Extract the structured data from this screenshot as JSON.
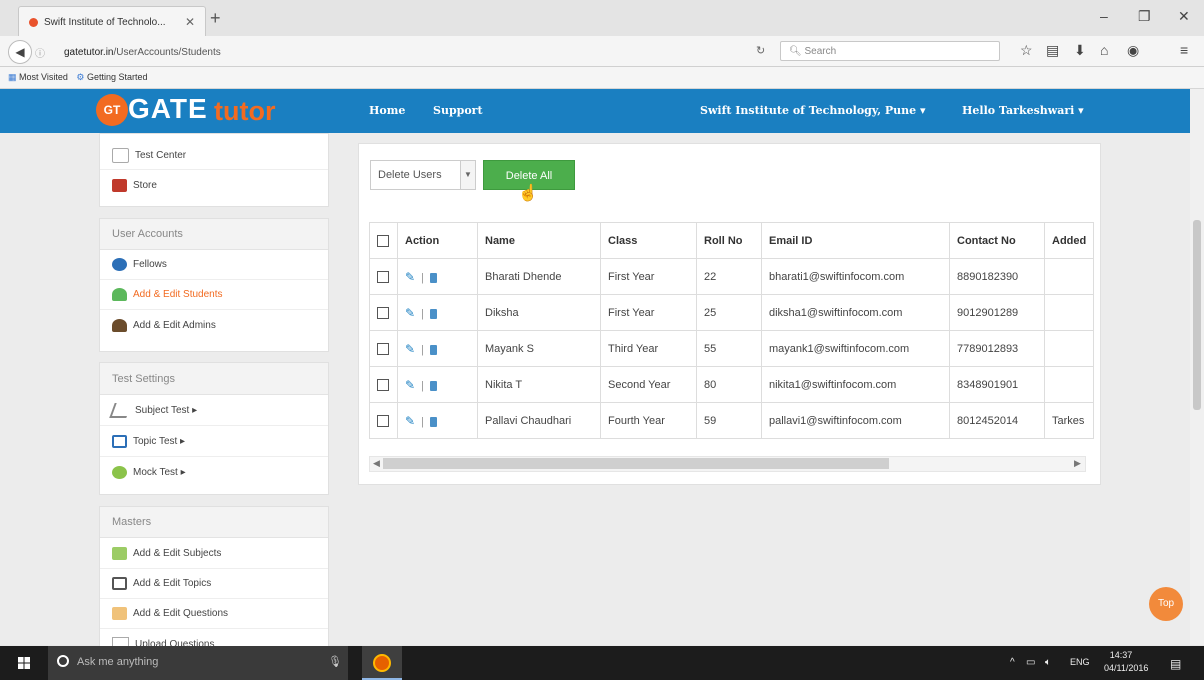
{
  "browser": {
    "tab_title": "Swift Institute of Technolo...",
    "url_host": "gatetutor.in",
    "url_path": "/UserAccounts/Students",
    "search_placeholder": "Search",
    "bookmark_most_visited": "Most Visited",
    "bookmark_getting_started": "Getting Started"
  },
  "site": {
    "logo_badge": "GT",
    "logo_gate": "GATE",
    "logo_tutor": "tutor",
    "nav_home": "Home",
    "nav_support": "Support",
    "institute": "Swift Institute of Technology, Pune ▾",
    "greeting": "Hello Tarkeshwari ▾"
  },
  "sidebar": {
    "top_items": [
      {
        "label": "Test Center",
        "icon": "test-center-icon"
      },
      {
        "label": "Store",
        "icon": "store-icon"
      }
    ],
    "user_accounts": {
      "title": "User Accounts",
      "items": [
        {
          "label": "Fellows",
          "icon": "fellows-icon"
        },
        {
          "label": "Add & Edit Students",
          "icon": "add-student-icon",
          "active": true
        },
        {
          "label": "Add & Edit Admins",
          "icon": "admin-icon"
        }
      ]
    },
    "test_settings": {
      "title": "Test Settings",
      "items": [
        {
          "label": "Subject Test ▸",
          "icon": "subject-test-icon"
        },
        {
          "label": "Topic Test ▸",
          "icon": "topic-test-icon"
        },
        {
          "label": "Mock Test ▸",
          "icon": "mock-test-icon"
        }
      ]
    },
    "masters": {
      "title": "Masters",
      "items": [
        {
          "label": "Add & Edit Subjects",
          "icon": "subjects-icon"
        },
        {
          "label": "Add & Edit Topics",
          "icon": "topics-icon"
        },
        {
          "label": "Add & Edit Questions",
          "icon": "questions-icon"
        },
        {
          "label": "Upload Questions",
          "icon": "upload-icon"
        }
      ]
    }
  },
  "main": {
    "bulk_select_value": "Delete Users",
    "delete_all_label": "Delete All",
    "columns": [
      "Action",
      "Name",
      "Class",
      "Roll No",
      "Email ID",
      "Contact No",
      "Added"
    ],
    "rows": [
      {
        "name": "Bharati Dhende",
        "class": "First Year",
        "roll": "22",
        "email": "bharati1@swiftinfocom.com",
        "contact": "8890182390",
        "added": ""
      },
      {
        "name": "Diksha",
        "class": "First Year",
        "roll": "25",
        "email": "diksha1@swiftinfocom.com",
        "contact": "9012901289",
        "added": ""
      },
      {
        "name": "Mayank S",
        "class": "Third Year",
        "roll": "55",
        "email": "mayank1@swiftinfocom.com",
        "contact": "7789012893",
        "added": ""
      },
      {
        "name": "Nikita T",
        "class": "Second Year",
        "roll": "80",
        "email": "nikita1@swiftinfocom.com",
        "contact": "8348901901",
        "added": ""
      },
      {
        "name": "Pallavi Chaudhari",
        "class": "Fourth Year",
        "roll": "59",
        "email": "pallavi1@swiftinfocom.com",
        "contact": "8012452014",
        "added": "Tarkes"
      }
    ],
    "top_button": "Top"
  },
  "taskbar": {
    "search_placeholder": "Ask me anything",
    "lang": "ENG",
    "time": "14:37",
    "date": "04/11/2016"
  },
  "colors": {
    "header_blue": "#1a7fc1",
    "brand_orange": "#f26b21",
    "delete_green": "#4cae4c"
  }
}
